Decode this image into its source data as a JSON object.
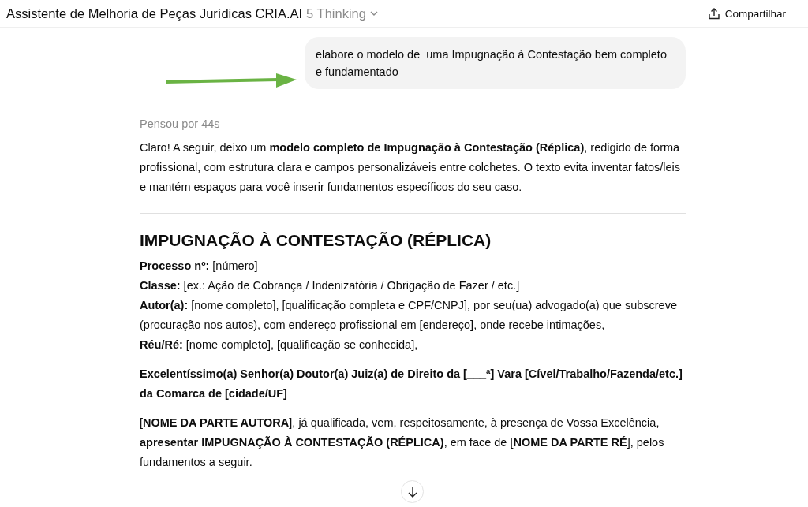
{
  "header": {
    "title": "Assistente de Melhoria de Peças Jurídicas CRIA.AI",
    "model": "5 Thinking",
    "share_label": "Compartilhar"
  },
  "user_message": "elabore o modelo de  uma Impugnação à Contestação bem completo e fundamentado",
  "thought_time": "Pensou por 44s",
  "intro": "Claro! A seguir, deixo um **modelo completo de Impugnação à Contestação (Réplica)**, redigido de forma profissional, com estrutura clara e campos personalizáveis entre colchetes. O texto evita inventar fatos/leis e mantém espaços para você inserir fundamentos específicos do seu caso.",
  "document": {
    "heading": "IMPUGNAÇÃO À CONTESTAÇÃO (RÉPLICA)",
    "fields": [
      "**Processo nº:** [número]",
      "**Classe:** [ex.: Ação de Cobrança / Indenizatória / Obrigação de Fazer / etc.]",
      "**Autor(a):** [nome completo], [qualificação completa e CPF/CNPJ], por seu(ua) advogado(a) que subscreve (procuração nos autos), com endereço profissional em [endereço], onde recebe intimações,",
      "**Réu/Ré:** [nome completo], [qualificação se conhecida],"
    ],
    "addressee": "Excelentíssimo(a) Senhor(a) Doutor(a) Juiz(a) de Direito da [___ª] Vara [Cível/Trabalho/Fazenda/etc.] da Comarca de [cidade/UF]",
    "opening": "[**NOME DA PARTE AUTORA**], já qualificada, vem, respeitosamente, à presença de Vossa Excelência, **apresentar IMPUGNAÇÃO À CONTESTAÇÃO (RÉPLICA)**, em face de [**NOME DA PARTE RÉ**], pelos fundamentos a seguir."
  }
}
